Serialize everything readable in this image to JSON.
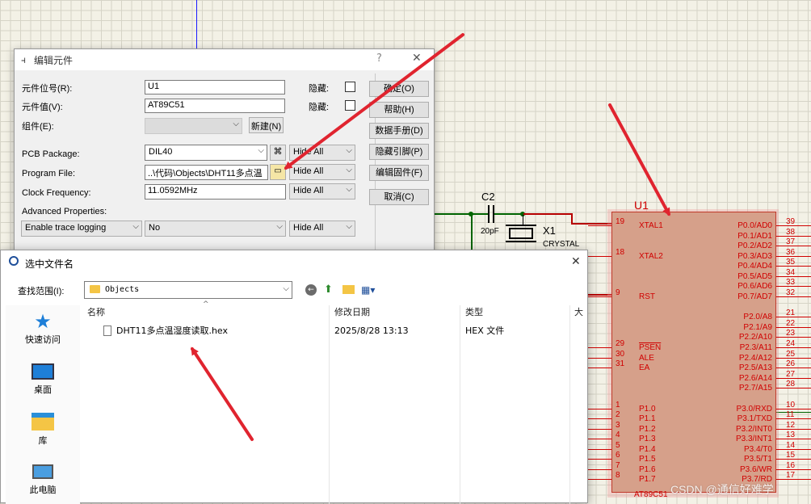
{
  "schematic": {
    "capacitor": {
      "ref": "C2",
      "value": "20pF"
    },
    "crystal": {
      "ref": "X1",
      "type": "CRYSTAL"
    },
    "chip": {
      "ref": "U1",
      "part": "AT89C51",
      "left_pins": [
        {
          "num": "19",
          "name": "XTAL1"
        },
        {
          "num": "18",
          "name": "XTAL2"
        },
        {
          "num": "9",
          "name": "RST"
        },
        {
          "num": "29",
          "name": "PSEN"
        },
        {
          "num": "30",
          "name": "ALE"
        },
        {
          "num": "31",
          "name": "EA"
        },
        {
          "num": "1",
          "name": "P1.0"
        },
        {
          "num": "2",
          "name": "P1.1"
        },
        {
          "num": "3",
          "name": "P1.2"
        },
        {
          "num": "4",
          "name": "P1.3"
        },
        {
          "num": "5",
          "name": "P1.4"
        },
        {
          "num": "6",
          "name": "P1.5"
        },
        {
          "num": "7",
          "name": "P1.6"
        },
        {
          "num": "8",
          "name": "P1.7"
        }
      ],
      "right_pins": [
        {
          "num": "39",
          "name": "P0.0/AD0"
        },
        {
          "num": "38",
          "name": "P0.1/AD1"
        },
        {
          "num": "37",
          "name": "P0.2/AD2"
        },
        {
          "num": "36",
          "name": "P0.3/AD3"
        },
        {
          "num": "35",
          "name": "P0.4/AD4"
        },
        {
          "num": "34",
          "name": "P0.5/AD5"
        },
        {
          "num": "33",
          "name": "P0.6/AD6"
        },
        {
          "num": "32",
          "name": "P0.7/AD7"
        },
        {
          "num": "21",
          "name": "P2.0/A8"
        },
        {
          "num": "22",
          "name": "P2.1/A9"
        },
        {
          "num": "23",
          "name": "P2.2/A10"
        },
        {
          "num": "24",
          "name": "P2.3/A11"
        },
        {
          "num": "25",
          "name": "P2.4/A12"
        },
        {
          "num": "26",
          "name": "P2.5/A13"
        },
        {
          "num": "27",
          "name": "P2.6/A14"
        },
        {
          "num": "28",
          "name": "P2.7/A15"
        },
        {
          "num": "10",
          "name": "P3.0/RXD"
        },
        {
          "num": "11",
          "name": "P3.1/TXD"
        },
        {
          "num": "12",
          "name": "P3.2/INT0"
        },
        {
          "num": "13",
          "name": "P3.3/INT1"
        },
        {
          "num": "14",
          "name": "P3.4/T0"
        },
        {
          "num": "15",
          "name": "P3.5/T1"
        },
        {
          "num": "16",
          "name": "P3.6/WR"
        },
        {
          "num": "17",
          "name": "P3.7/RD"
        }
      ]
    },
    "watermark": "CSDN @通信好难学"
  },
  "edit_dialog": {
    "title": "编辑元件",
    "help_glyph": "?",
    "close_glyph": "✕",
    "ref_label": "元件位号(R):",
    "ref_value": "U1",
    "value_label": "元件值(V):",
    "value_value": "AT89C51",
    "group_label": "组件(E):",
    "group_value": "",
    "hidden_label": "隐藏:",
    "new_button": "新建(N)",
    "pcb_label": "PCB Package:",
    "pcb_value": "DIL40",
    "program_label": "Program File:",
    "program_value": "..\\代码\\Objects\\DHT11多点温",
    "clock_label": "Clock Frequency:",
    "clock_value": "11.0592MHz",
    "advanced_label": "Advanced Properties:",
    "adv_prop": "Enable trace logging",
    "adv_value": "No",
    "hide_all": "Hide All",
    "buttons": {
      "ok": "确定(O)",
      "help": "帮助(H)",
      "datasheet": "数据手册(D)",
      "hidden_pins": "隐藏引脚(P)",
      "edit_firmware": "编辑固件(F)",
      "cancel": "取消(C)"
    }
  },
  "file_dialog": {
    "title": "选中文件名",
    "close_glyph": "✕",
    "lookin_label": "查找范围(I):",
    "lookin_value": "Objects",
    "places": [
      {
        "label": "快速访问",
        "icon": "star-icon"
      },
      {
        "label": "桌面",
        "icon": "desktop-icon"
      },
      {
        "label": "库",
        "icon": "library-icon"
      },
      {
        "label": "此电脑",
        "icon": "computer-icon"
      }
    ],
    "columns": {
      "name": "名称",
      "date": "修改日期",
      "type": "类型",
      "size": "大"
    },
    "files": [
      {
        "name": "DHT11多点温湿度读取.hex",
        "date": "2025/8/28 13:13",
        "type": "HEX 文件"
      }
    ]
  },
  "colors": {
    "schematic_red": "#d00000",
    "chip_fill": "#d6a08a",
    "arrow": "#e0242f",
    "grid": "#d6d4c7"
  }
}
